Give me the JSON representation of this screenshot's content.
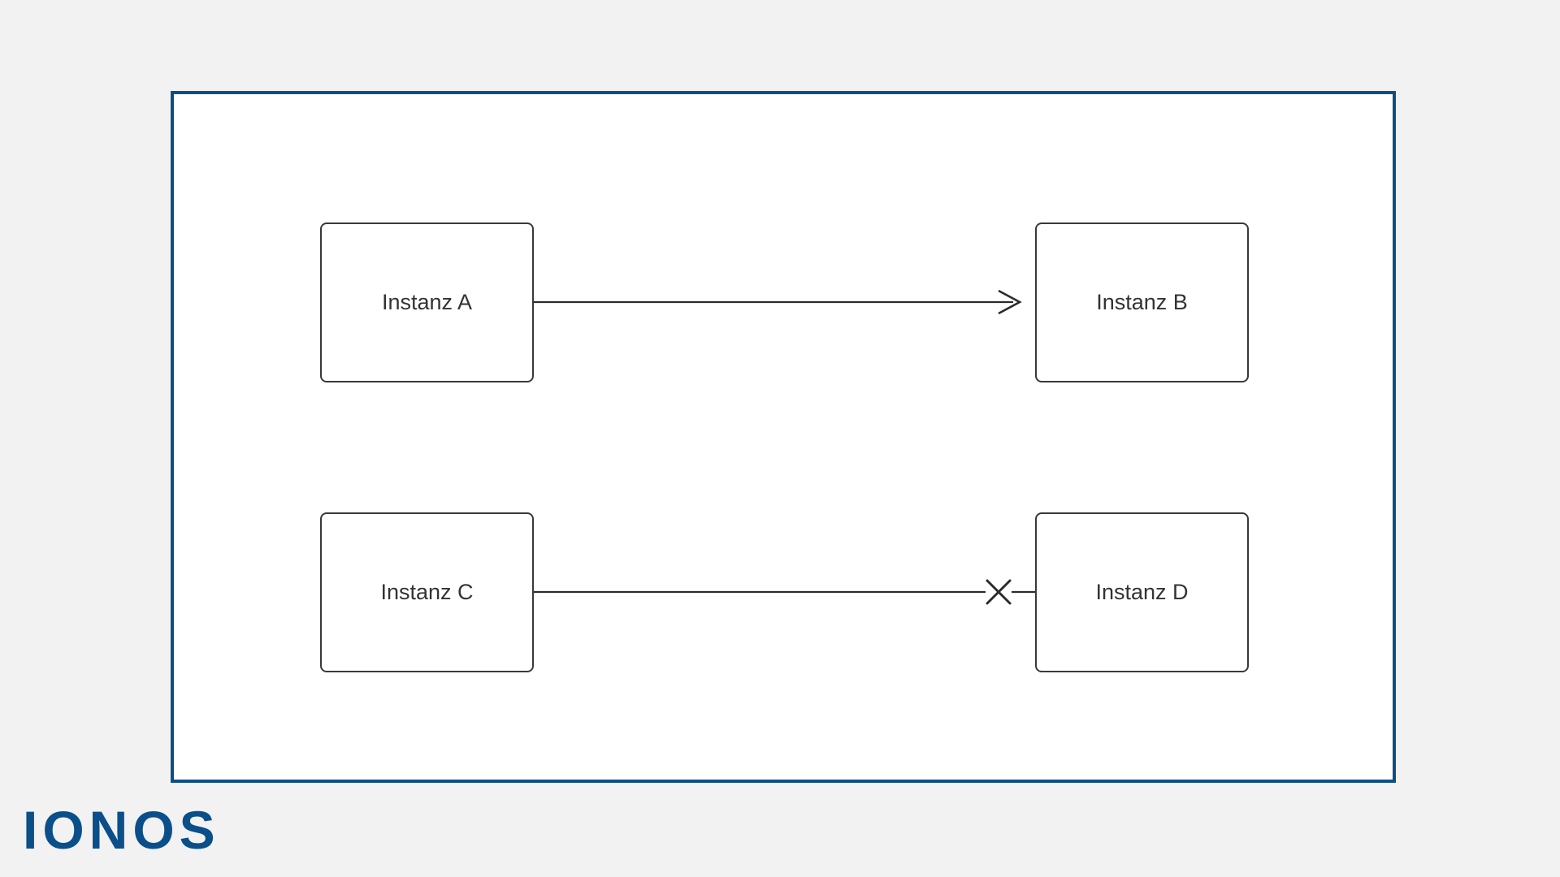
{
  "brand": {
    "logo_text": "IONOS"
  },
  "diagram": {
    "frame_color": "#0b4f8a",
    "nodes": {
      "a": {
        "label": "Instanz A"
      },
      "b": {
        "label": "Instanz B"
      },
      "c": {
        "label": "Instanz C"
      },
      "d": {
        "label": "Instanz D"
      }
    },
    "connectors": [
      {
        "from": "a",
        "to": "b",
        "style": "arrow-open"
      },
      {
        "from": "c",
        "to": "d",
        "style": "blocked-x"
      }
    ]
  }
}
